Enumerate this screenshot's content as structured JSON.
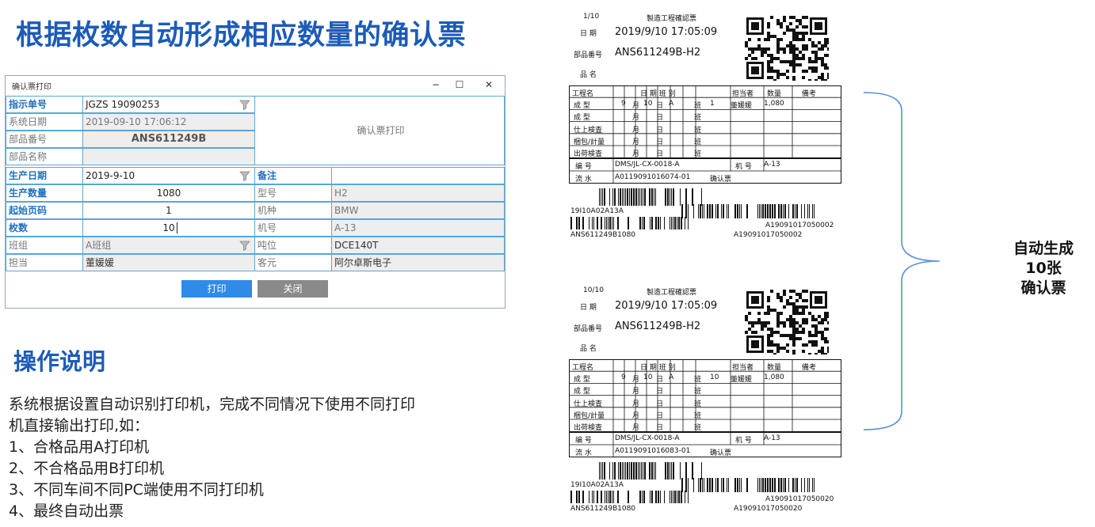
{
  "title": "根据枚数自动形成相应数量的确认票",
  "window": {
    "title": "确认票打印",
    "minimize": "−",
    "maximize": "☐",
    "close": "✕"
  },
  "form": {
    "order_label": "指示单号",
    "order_value": "JGZS 19090253",
    "sysdate_label": "系统日期",
    "sysdate_value": "2019-09-10 17:06:12",
    "part_no_label": "部品番号",
    "part_no_value": "ANS611249B",
    "part_name_label": "部品名称",
    "part_name_value": "",
    "print_area": "确认票打印",
    "prod_date_label": "生产日期",
    "prod_date_value": "2019-9-10",
    "remark_label": "备注",
    "remark_value": "",
    "qty_label": "生产数量",
    "qty_value": "1080",
    "type_label": "型号",
    "type_value": "H2",
    "start_label": "起始页码",
    "start_value": "1",
    "model_label": "机种",
    "model_value": "BMW",
    "count_label": "枚数",
    "count_value": "10",
    "machine_label": "机号",
    "machine_value": "A-13",
    "team_label": "班组",
    "team_value": "A班组",
    "tonnage_label": "吨位",
    "tonnage_value": "DCE140T",
    "owner_label": "担当",
    "owner_value": "董媛媛",
    "customer_label": "客元",
    "customer_value": "阿尔卓斯电子",
    "print_btn": "打印",
    "close_btn": "关闭"
  },
  "instructions": {
    "heading": "操作说明",
    "line1": "系统根据设置自动识别打印机，完成不同情况下使用不同打印",
    "line2": "机直接输出打印,如：",
    "item1": "1、合格品用A打印机",
    "item2": "2、不合格品用B打印机",
    "item3": "3、不同车间不同PC端使用不同打印机",
    "item4": "4、最终自动出票"
  },
  "tickets": [
    {
      "page": "1/10",
      "heading": "製造工程確認票",
      "date_label": "日 期",
      "date": "2019/9/10 17:05:09",
      "part_label": "部品番号",
      "part": "ANS611249B-H2",
      "name_label": "品 名",
      "cols": [
        "工程名",
        "日 期 班 别",
        "担当者",
        "数量",
        "備考"
      ],
      "rows": [
        "成 型",
        "成 型",
        "仕上検査",
        "梱包/計量",
        "出荷検査"
      ],
      "m": "月",
      "d": "日",
      "b": "班",
      "r1_month": "9",
      "r1_day": "10",
      "r1_shift": "A",
      "r1_no": "1",
      "r1_owner": "董媛媛",
      "r1_qty": "1,080",
      "code_label": "编 号",
      "code": "DMS/JL-CX-0018-A",
      "machine_label": "机 号",
      "machine": "A-13",
      "flow_label": "流 水",
      "flow": "A0119091016074-01",
      "confirm": "确认票",
      "bc1": "19I10A02A13A",
      "bc2": "A19091017050002",
      "bc3": "ANS611249B1080",
      "bc4": "A19091017050002"
    },
    {
      "page": "10/10",
      "heading": "製造工程確認票",
      "date_label": "日 期",
      "date": "2019/9/10 17:05:09",
      "part_label": "部品番号",
      "part": "ANS611249B-H2",
      "name_label": "品 名",
      "cols": [
        "工程名",
        "日 期 班 别",
        "担当者",
        "数量",
        "備考"
      ],
      "rows": [
        "成 型",
        "成 型",
        "仕上検査",
        "梱包/計量",
        "出荷検査"
      ],
      "m": "月",
      "d": "日",
      "b": "班",
      "r1_month": "9",
      "r1_day": "10",
      "r1_shift": "A",
      "r1_no": "10",
      "r1_owner": "董媛媛",
      "r1_qty": "1,080",
      "code_label": "编 号",
      "code": "DMS/JL-CX-0018-A",
      "machine_label": "机 号",
      "machine": "A-13",
      "flow_label": "流 水",
      "flow": "A0119091016083-01",
      "confirm": "确认票",
      "bc1": "19I10A02A13A",
      "bc2": "A19091017050020",
      "bc3": "ANS611249B1080",
      "bc4": "A19091017050020"
    }
  ],
  "summary": {
    "line1": "自动生成",
    "line2": "10张",
    "line3": "确认票"
  }
}
